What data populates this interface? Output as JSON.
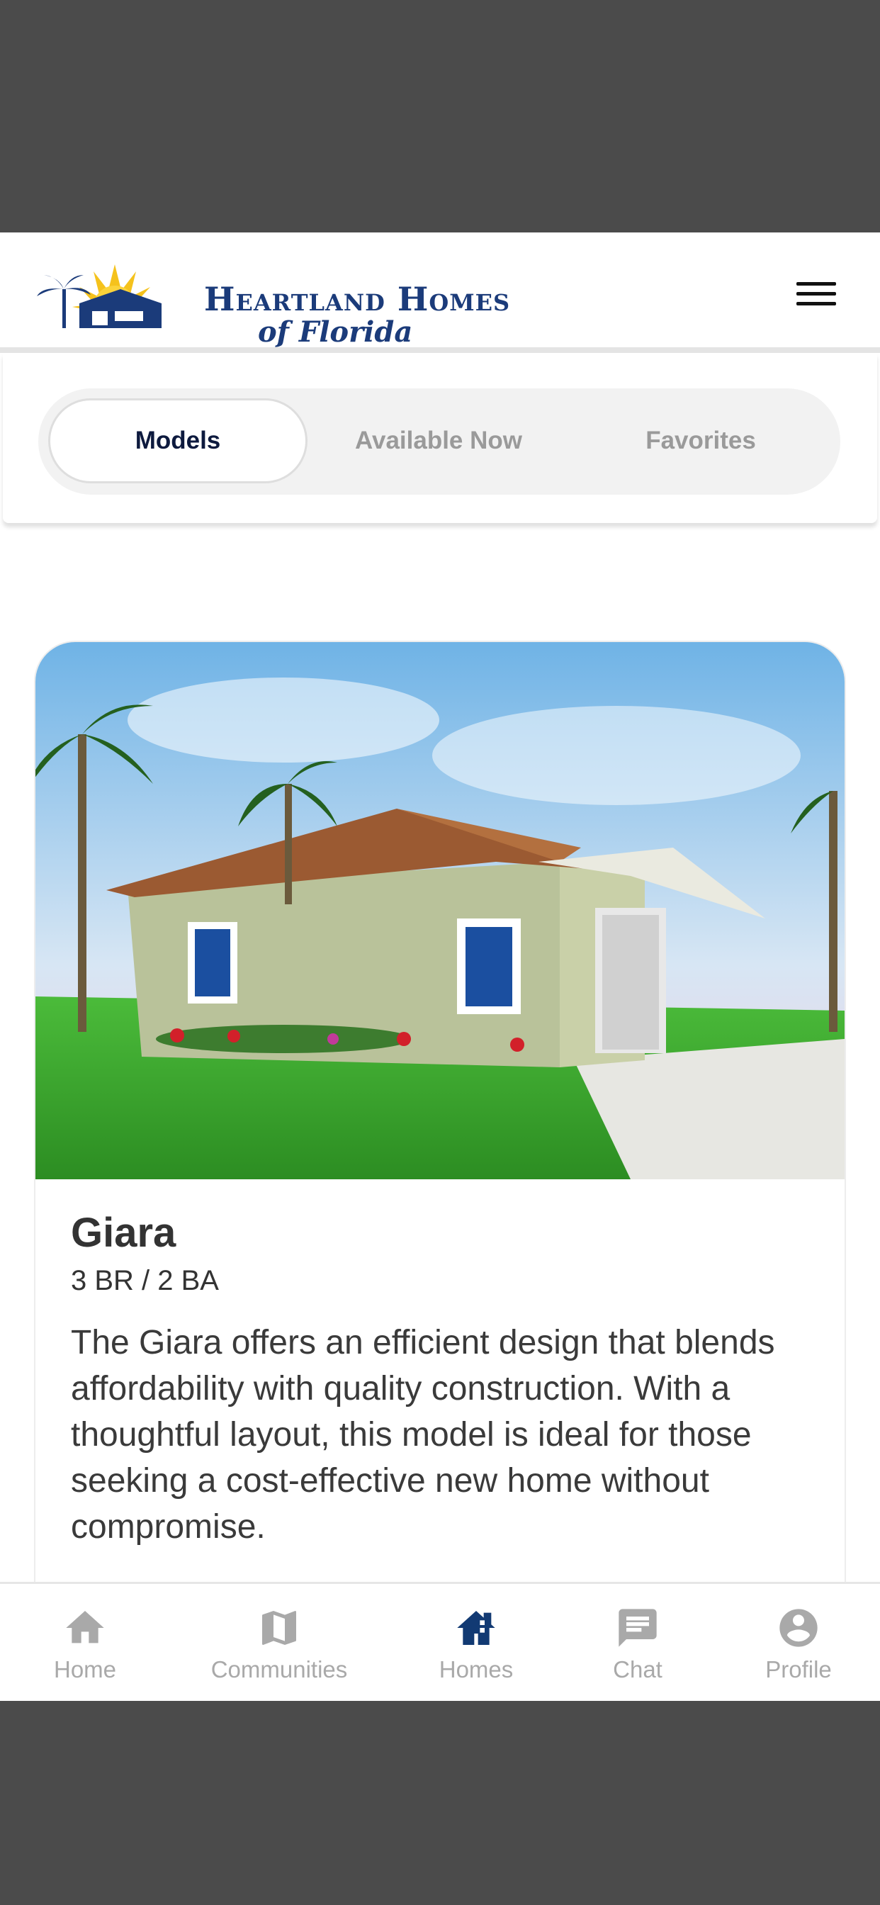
{
  "header": {
    "brand_line1": "Heartland Homes",
    "brand_line2": "of Florida",
    "menu_icon": "hamburger-menu-icon"
  },
  "segments": [
    {
      "label": "Models",
      "active": true
    },
    {
      "label": "Available Now",
      "active": false
    },
    {
      "label": "Favorites",
      "active": false
    }
  ],
  "card": {
    "title": "Giara",
    "specs": "3 BR / 2 BA",
    "description": "The Giara offers an efficient design that blends affordability with quality construction. With a thoughtful layout, this model is ideal for those seeking a cost-effective new home without compromise."
  },
  "tabs": [
    {
      "label": "Home",
      "icon": "home-icon",
      "active": false
    },
    {
      "label": "Communities",
      "icon": "map-icon",
      "active": false
    },
    {
      "label": "Homes",
      "icon": "homes-icon",
      "active": true
    },
    {
      "label": "Chat",
      "icon": "chat-icon",
      "active": false
    },
    {
      "label": "Profile",
      "icon": "profile-icon",
      "active": false
    }
  ],
  "colors": {
    "brand_navy": "#1b3b7a",
    "active_tab": "#123a73",
    "inactive": "#a9a9a9",
    "frame": "#4b4b4b"
  }
}
